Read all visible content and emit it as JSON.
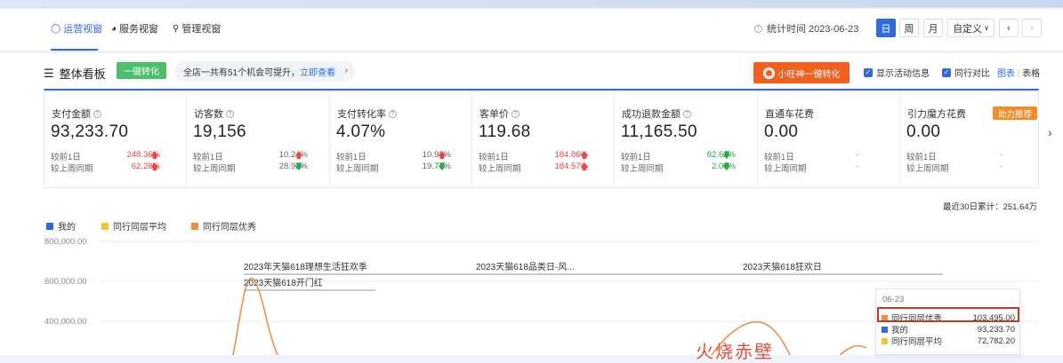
{
  "nav": {
    "tabs": [
      {
        "label": "运营视窗",
        "icon": "shield-icon"
      },
      {
        "label": "服务视窗",
        "icon": "headset-icon"
      },
      {
        "label": "管理视窗",
        "icon": "lock-icon"
      }
    ],
    "stat_time": "统计时间 2023-06-23",
    "periods": [
      "日",
      "周",
      "月",
      "自定义"
    ],
    "period_active": "日"
  },
  "board": {
    "title": "整体看板",
    "one_click": "一键转化",
    "hint_text": "全店一共有51个机会可提升，",
    "hint_link": "立即查看",
    "xiaowang_btn": "小旺神一键转化",
    "show_activity": "显示活动信息",
    "peer_compare": "同行对比",
    "view_chart": "图表",
    "view_sep": "|",
    "view_table": "表格"
  },
  "metrics": [
    {
      "label": "支付金额",
      "value": "93,233.70",
      "row1": "较前1日",
      "row2": "较上周同期",
      "pct1": "248.36%",
      "pct2": "62.28%",
      "dir1": "up",
      "dir2": "up"
    },
    {
      "label": "访客数",
      "value": "19,156",
      "row1": "较前1日",
      "row2": "较上周同期",
      "pct1": "10.24%",
      "pct2": "28.92%",
      "dir1": "up",
      "dir2": "down"
    },
    {
      "label": "支付转化率",
      "value": "4.07%",
      "row1": "较前1日",
      "row2": "较上周同期",
      "pct1": "10.93%",
      "pct2": "19.77%",
      "dir1": "up",
      "dir2": "down"
    },
    {
      "label": "客单价",
      "value": "119.68",
      "row1": "较前1日",
      "row2": "较上周同期",
      "pct1": "184.86%",
      "pct2": "184.57%",
      "dir1": "up",
      "dir2": "up"
    },
    {
      "label": "成功退款金额",
      "value": "11,165.50",
      "row1": "较前1日",
      "row2": "较上周同期",
      "pct1": "82.62%",
      "pct2": "2.00%",
      "dir1": "down",
      "dir2": "down"
    },
    {
      "label": "直通车花费",
      "value": "0.00",
      "row1": "较前1日",
      "row2": "较上周同期",
      "pct1": "-",
      "pct2": "-",
      "dir1": "none",
      "dir2": "none"
    },
    {
      "label": "引力魔方花费",
      "value": "0.00",
      "row1": "较前1日",
      "row2": "较上周同期",
      "pct1": "-",
      "pct2": "-",
      "dir1": "none",
      "dir2": "none",
      "badge": "助力推荐"
    }
  ],
  "total30": "最近30日累计：251.64万",
  "chart_data": {
    "type": "line",
    "series": [
      {
        "name": "我的",
        "color": "#2f6bdd"
      },
      {
        "name": "同行同层平均",
        "color": "#f2c230"
      },
      {
        "name": "同行同层优秀",
        "color": "#f08a3c"
      }
    ],
    "yticks": [
      "800,000.00",
      "600,000.00",
      "400,000.00"
    ],
    "ylim": [
      400000,
      800000
    ],
    "events": [
      {
        "label": "2023年天猫618理想生活狂欢季"
      },
      {
        "label": "2023天猫618开门红"
      },
      {
        "label": "2023天猫618品类日-风..."
      },
      {
        "label": "2023天猫618狂欢日"
      }
    ]
  },
  "tooltip": {
    "date": "06-23",
    "rows": [
      {
        "name": "同行同层优秀",
        "value": "103,495.00",
        "color": "#f08a3c"
      },
      {
        "name": "我的",
        "value": "93,233.70",
        "color": "#2f6bdd"
      },
      {
        "name": "同行同层平均",
        "value": "72,782.20",
        "color": "#f2c230"
      }
    ]
  },
  "watermark": "火烧赤壁"
}
